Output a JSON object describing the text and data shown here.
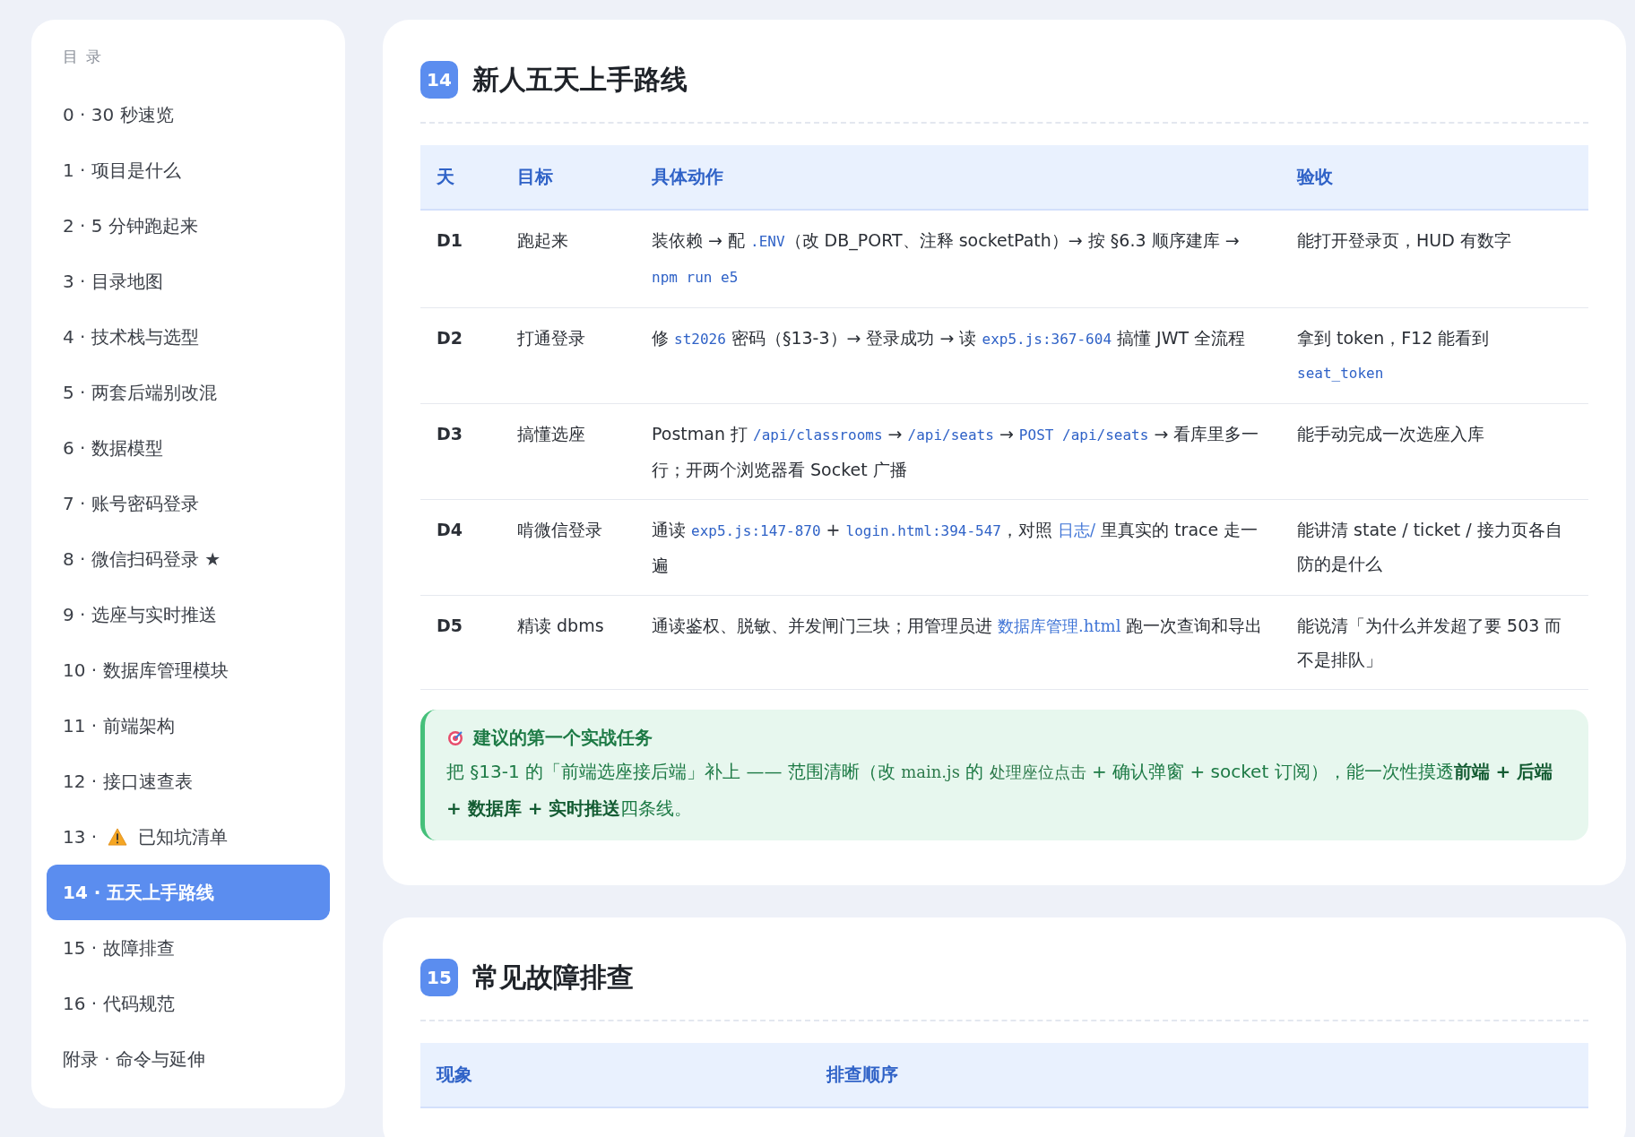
{
  "sidebar": {
    "title": "目 录",
    "items": [
      {
        "label": "0 · 30 秒速览",
        "selected": false
      },
      {
        "label": "1 · 项目是什么",
        "selected": false
      },
      {
        "label": "2 · 5 分钟跑起来",
        "selected": false
      },
      {
        "label": "3 · 目录地图",
        "selected": false
      },
      {
        "label": "4 · 技术栈与选型",
        "selected": false
      },
      {
        "label": "5 · 两套后端别改混",
        "selected": false
      },
      {
        "label": "6 · 数据模型",
        "selected": false
      },
      {
        "label": "7 · 账号密码登录",
        "selected": false
      },
      {
        "label": "8 · 微信扫码登录 ★",
        "selected": false
      },
      {
        "label": "9 · 选座与实时推送",
        "selected": false
      },
      {
        "label": "10 · 数据库管理模块",
        "selected": false
      },
      {
        "label": "11 · 前端架构",
        "selected": false
      },
      {
        "label": "12 · 接口速查表",
        "selected": false
      },
      {
        "label": "13 · ",
        "kind": "warning",
        "after": "已知坑清单",
        "selected": false
      },
      {
        "label": "14 · 五天上手路线",
        "selected": true
      },
      {
        "label": "15 · 故障排查",
        "selected": false
      },
      {
        "label": "16 · 代码规范",
        "selected": false
      },
      {
        "label": "附录 · 命令与延伸",
        "selected": false
      }
    ]
  },
  "sections": [
    {
      "number": "14",
      "title": "新人五天上手路线",
      "table": {
        "columns": [
          "天",
          "目标",
          "具体动作",
          "验收"
        ],
        "rows": [
          {
            "cells": [
              [
                {
                  "kind": "text",
                  "text": "D1"
                }
              ],
              [
                {
                  "kind": "text",
                  "text": "跑起来"
                }
              ],
              [
                {
                  "kind": "text",
                  "text": "装依赖 → 配 "
                },
                {
                  "kind": "code",
                  "text": ".ENV"
                },
                {
                  "kind": "text",
                  "text": "（改 DB_PORT、注释 socketPath）→ 按 §6.3 顺序建库 → "
                },
                {
                  "kind": "code",
                  "text": "npm run e5"
                }
              ],
              [
                {
                  "kind": "text",
                  "text": "能打开登录页，HUD 有数字"
                }
              ]
            ]
          },
          {
            "cells": [
              [
                {
                  "kind": "text",
                  "text": "D2"
                }
              ],
              [
                {
                  "kind": "text",
                  "text": "打通登录"
                }
              ],
              [
                {
                  "kind": "text",
                  "text": "修 "
                },
                {
                  "kind": "code",
                  "text": "st2026"
                },
                {
                  "kind": "text",
                  "text": " 密码（§13-3）→ 登录成功 → 读 "
                },
                {
                  "kind": "code",
                  "text": "exp5.js:367-604"
                },
                {
                  "kind": "text",
                  "text": " 搞懂 JWT 全流程"
                }
              ],
              [
                {
                  "kind": "text",
                  "text": "拿到 token，F12 能看到 "
                },
                {
                  "kind": "code",
                  "text": "seat_token"
                }
              ]
            ]
          },
          {
            "cells": [
              [
                {
                  "kind": "text",
                  "text": "D3"
                }
              ],
              [
                {
                  "kind": "text",
                  "text": "搞懂选座"
                }
              ],
              [
                {
                  "kind": "text",
                  "text": "Postman 打 "
                },
                {
                  "kind": "code",
                  "text": "/api/classrooms"
                },
                {
                  "kind": "text",
                  "text": " → "
                },
                {
                  "kind": "code",
                  "text": "/api/seats"
                },
                {
                  "kind": "text",
                  "text": " → "
                },
                {
                  "kind": "code",
                  "text": "POST /api/seats"
                },
                {
                  "kind": "text",
                  "text": " → 看库里多一行；开两个浏览器看 Socket 广播"
                }
              ],
              [
                {
                  "kind": "text",
                  "text": "能手动完成一次选座入库"
                }
              ]
            ]
          },
          {
            "cells": [
              [
                {
                  "kind": "text",
                  "text": "D4"
                }
              ],
              [
                {
                  "kind": "text",
                  "text": "啃微信登录"
                }
              ],
              [
                {
                  "kind": "text",
                  "text": "通读 "
                },
                {
                  "kind": "code",
                  "text": "exp5.js:147-870"
                },
                {
                  "kind": "text",
                  "text": " + "
                },
                {
                  "kind": "code",
                  "text": "login.html:394-547"
                },
                {
                  "kind": "text",
                  "text": "，对照 "
                },
                {
                  "kind": "path",
                  "text": "日志/"
                },
                {
                  "kind": "text",
                  "text": " 里真实的 trace 走一遍"
                }
              ],
              [
                {
                  "kind": "text",
                  "text": "能讲清 state / ticket / 接力页各自防的是什么"
                }
              ]
            ]
          },
          {
            "cells": [
              [
                {
                  "kind": "text",
                  "text": "D5"
                }
              ],
              [
                {
                  "kind": "text",
                  "text": "精读 dbms"
                }
              ],
              [
                {
                  "kind": "text",
                  "text": "通读鉴权、脱敏、并发闸门三块；用管理员进 "
                },
                {
                  "kind": "path",
                  "text": "数据库管理.html"
                },
                {
                  "kind": "text",
                  "text": " 跑一次查询和导出"
                }
              ],
              [
                {
                  "kind": "text",
                  "text": "能说清「为什么并发超了要 503 而不是排队」"
                }
              ]
            ]
          }
        ]
      },
      "callout": {
        "title": "建议的第一个实战任务",
        "body": [
          {
            "kind": "text",
            "text": "把 §13-1 的「前端选座接后端」补上 —— 范围清晰（改 "
          },
          {
            "kind": "path",
            "text": "main.js"
          },
          {
            "kind": "text",
            "text": " 的 "
          },
          {
            "kind": "path",
            "text": "处理座位点击"
          },
          {
            "kind": "text",
            "text": " + 确认弹窗 + socket 订阅），能一次性摸透"
          },
          {
            "kind": "bold",
            "text": "前端 + 后端 + 数据库 + 实时推送"
          },
          {
            "kind": "text",
            "text": "四条线。"
          }
        ]
      }
    },
    {
      "number": "15",
      "title": "常见故障排查",
      "table": {
        "columns": [
          "现象",
          "排查顺序"
        ]
      }
    }
  ]
}
